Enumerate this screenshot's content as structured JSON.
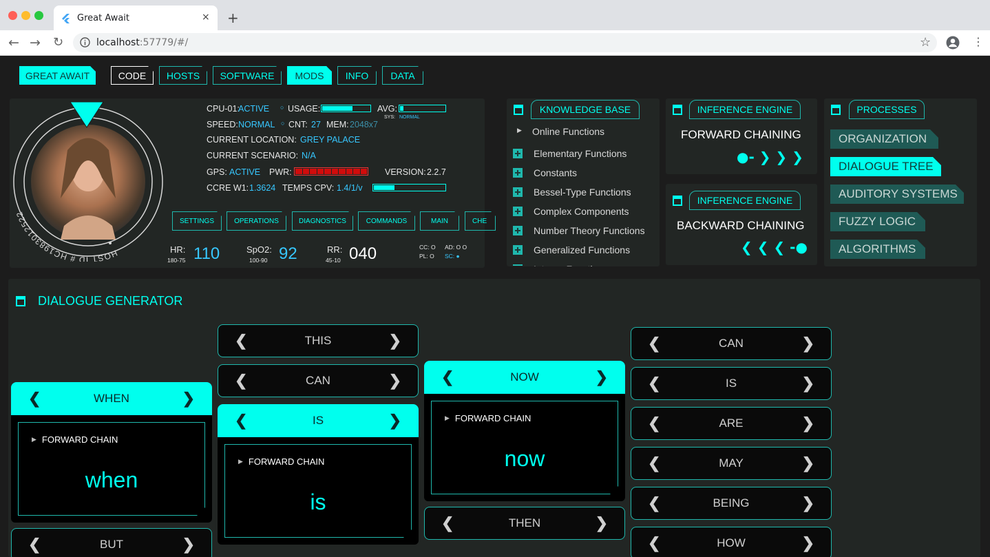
{
  "browser": {
    "tab_title": "Great Await",
    "tab_close": "×",
    "new_tab": "+",
    "url_host": "localhost",
    "url_rest": ":57779/#/"
  },
  "nav": {
    "brand": "GREAT AWAIT",
    "items": [
      "CODE",
      "HOSTS",
      "SOFTWARE",
      "MODS",
      "INFO",
      "DATA"
    ]
  },
  "host": {
    "id_text": "HOST ID # HC1983012522",
    "cpu_label": "CPU-01:",
    "cpu_value": "ACTIVE",
    "usage_label": "USAGE:",
    "usage_fraction": 0.65,
    "avg_label": "AVG:",
    "avg_fraction": 0.1,
    "sys_label": "SYS:",
    "sys_value": "NORMAL",
    "speed_label": "SPEED:",
    "speed_value": "NORMAL",
    "cnt_label": "CNT:",
    "cnt_value": "27",
    "mem_label": "MEM:",
    "mem_value": "2048x7",
    "location_label": "CURRENT LOCATION:",
    "location_value": "GREY PALACE",
    "scenario_label": "CURRENT SCENARIO:",
    "scenario_value": "N/A",
    "gps_label": "GPS:",
    "gps_value": "ACTIVE",
    "pwr_label": "PWR:",
    "pwr_segments": 10,
    "version_label": "VERSION:",
    "version_value": "2.2.7",
    "ccre_label": "CCRE W1:",
    "ccre_value": "1.3624",
    "temps_label": "TEMPS CPV:",
    "temps_value": "1.4/1/v",
    "temps_fraction": 0.3,
    "buttons": [
      "SETTINGS",
      "OPERATIONS",
      "DIAGNOSTICS",
      "COMMANDS",
      "MAIN",
      "CHE"
    ],
    "hr_label": "HR:",
    "hr_range": "180-75",
    "hr_value": "110",
    "spo2_label": "SpO2:",
    "spo2_range": "100-90",
    "spo2_value": "92",
    "rr_label": "RR:",
    "rr_range": "45-10",
    "rr_value": "040",
    "cc_text": "CC: O",
    "ad_text": "AD: O O",
    "pl_text": "PL:  O",
    "sc_text": "SC: ●"
  },
  "knowledge_base": {
    "title": "KNOWLEDGE BASE",
    "header_item": "Online Functions",
    "items": [
      "Elementary Functions",
      "Constants",
      "Bessel-Type Functions",
      "Complex Components",
      "Number Theory Functions",
      "Generalized Functions",
      "Integer Functions"
    ]
  },
  "inference": [
    {
      "title": "INFERENCE ENGINE",
      "mode": "FORWARD CHAINING",
      "glyphs": "●-   ❯ ❯ ❯"
    },
    {
      "title": "INFERENCE ENGINE",
      "mode": "BACKWARD CHAINING",
      "glyphs": "❮ ❮ ❮ -●"
    }
  ],
  "processes": {
    "title": "PROCESSES",
    "items": [
      {
        "label": "ORGANIZATION",
        "active": false
      },
      {
        "label": "DIALOGUE TREE",
        "active": true
      },
      {
        "label": "AUDITORY SYSTEMS",
        "active": false
      },
      {
        "label": "FUZZY LOGIC",
        "active": false
      },
      {
        "label": "ALGORITHMS",
        "active": false
      }
    ]
  },
  "dialogue": {
    "title": "DIALOGUE GENERATOR",
    "arrow_left": "❮",
    "arrow_right": "❯",
    "chain_label": "FORWARD CHAIN",
    "col1": {
      "selected": "WHEN",
      "card_word": "when",
      "below": "BUT"
    },
    "col2": {
      "above": [
        "THIS",
        "CAN"
      ],
      "selected": "IS",
      "card_word": "is"
    },
    "col3": {
      "selected": "NOW",
      "card_word": "now",
      "below": "THEN"
    },
    "col4": {
      "words": [
        "CAN",
        "IS",
        "ARE",
        "MAY",
        "BEING",
        "HOW"
      ]
    }
  },
  "colors": {
    "accent": "#00ffee",
    "panel": "#222624",
    "alert": "#d20c0c"
  }
}
